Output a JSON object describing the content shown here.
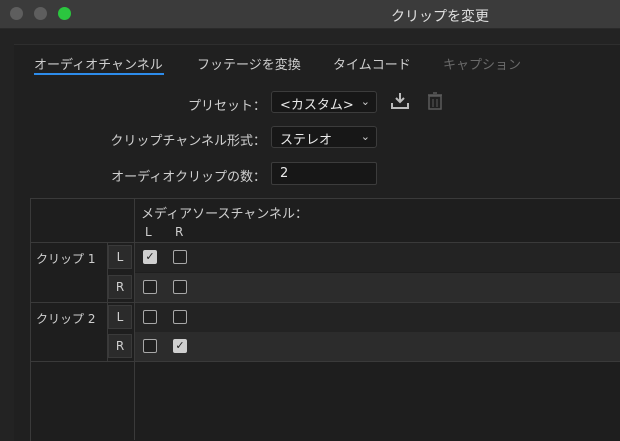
{
  "window": {
    "title": "クリップを変更"
  },
  "tabs": [
    {
      "label": "オーディオチャンネル",
      "active": true
    },
    {
      "label": "フッテージを変換",
      "active": false
    },
    {
      "label": "タイムコード",
      "active": false
    },
    {
      "label": "キャプション",
      "active": false,
      "disabled": true
    }
  ],
  "preset": {
    "label": "プリセット：",
    "value": "<カスタム>"
  },
  "channel_format": {
    "label": "クリップチャンネル形式：",
    "value": "ステレオ"
  },
  "audio_clips": {
    "label": "オーディオクリップの数：",
    "value": "2"
  },
  "matrix": {
    "media_source_header": "メディアソースチャンネル：",
    "source_columns": [
      "L",
      "R"
    ],
    "clips": [
      {
        "name": "クリップ 1",
        "rows": [
          {
            "channel": "L",
            "checks": [
              true,
              false
            ]
          },
          {
            "channel": "R",
            "checks": [
              false,
              false
            ]
          }
        ]
      },
      {
        "name": "クリップ 2",
        "rows": [
          {
            "channel": "L",
            "checks": [
              false,
              false
            ]
          },
          {
            "channel": "R",
            "checks": [
              false,
              true
            ]
          }
        ]
      }
    ]
  },
  "icons": {
    "save": "download-icon",
    "delete": "trash-icon",
    "dropdown": "chevron-down-icon",
    "check": "✓"
  },
  "colors": {
    "accent": "#2d8ceb",
    "close": "#5e5e5e",
    "minimize": "#5e5e5e",
    "maximize": "#2bc63f"
  }
}
